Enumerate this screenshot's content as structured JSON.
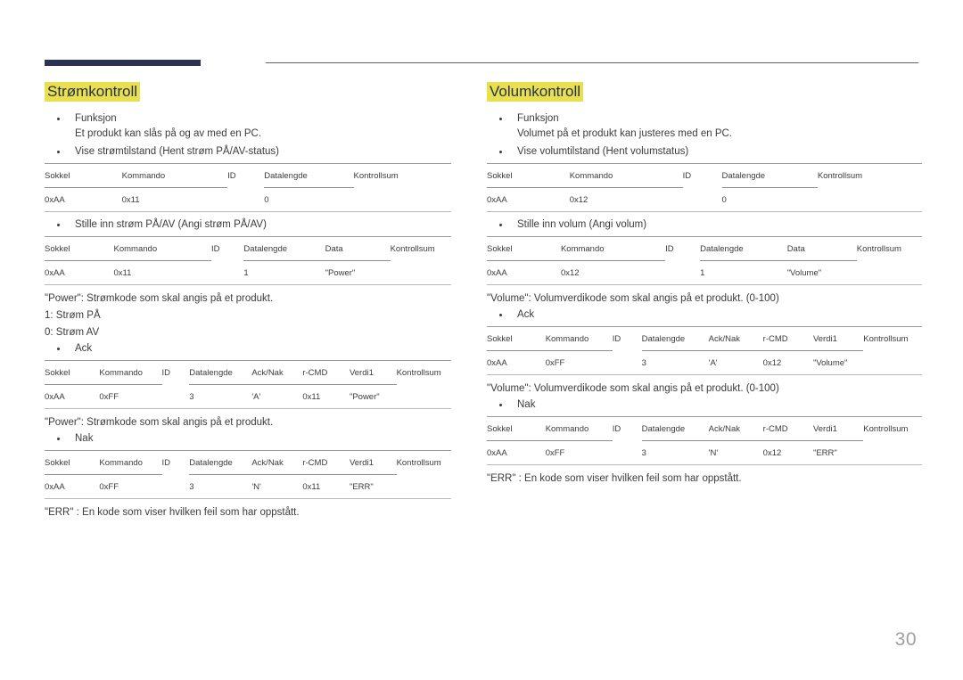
{
  "page": {
    "number": "30",
    "accent_bar_color": "#2b3254",
    "rule_color": "#5b5f75",
    "highlight_color": "#e9e04f",
    "heading_color": "#27304f"
  },
  "table_headers": {
    "sokkel": "Sokkel",
    "kommando": "Kommando",
    "id": "ID",
    "datalengde": "Datalengde",
    "kontrollsum": "Kontrollsum",
    "data": "Data",
    "acknak": "Ack/Nak",
    "rcmd": "r-CMD",
    "verdi1": "Verdi1"
  },
  "left": {
    "title": "Strømkontroll",
    "funksjon_label": "Funksjon",
    "funksjon_desc": "Et produkt kan slås på og av med en PC.",
    "view_state_label": "Vise strømtilstand (Hent strøm PÅ/AV-status)",
    "view_state_row": {
      "sokkel": "0xAA",
      "kommando": "0x11",
      "id": "",
      "datalengde": "0",
      "kontrollsum": ""
    },
    "set_state_label": "Stille inn strøm PÅ/AV (Angi strøm PÅ/AV)",
    "set_state_row": {
      "sokkel": "0xAA",
      "kommando": "0x11",
      "id": "",
      "datalengde": "1",
      "data": "\"Power\"",
      "kontrollsum": ""
    },
    "power_note": "\"Power\": Strømkode som skal angis på et produkt.",
    "power_on": "1: Strøm PÅ",
    "power_off": "0: Strøm AV",
    "ack_label": "Ack",
    "ack_row": {
      "sokkel": "0xAA",
      "kommando": "0xFF",
      "id": "",
      "datalengde": "3",
      "acknak": "'A'",
      "rcmd": "0x11",
      "verdi1": "\"Power\"",
      "kontrollsum": ""
    },
    "power_note_2": "\"Power\": Strømkode som skal angis på et produkt.",
    "nak_label": "Nak",
    "nak_row": {
      "sokkel": "0xAA",
      "kommando": "0xFF",
      "id": "",
      "datalengde": "3",
      "acknak": "'N'",
      "rcmd": "0x11",
      "verdi1": "\"ERR\"",
      "kontrollsum": ""
    },
    "err_note": "\"ERR\" : En kode som viser hvilken feil som har oppstått."
  },
  "right": {
    "title": "Volumkontroll",
    "funksjon_label": "Funksjon",
    "funksjon_desc": "Volumet på et produkt kan justeres med en PC.",
    "view_state_label": "Vise volumtilstand (Hent volumstatus)",
    "view_state_row": {
      "sokkel": "0xAA",
      "kommando": "0x12",
      "id": "",
      "datalengde": "0",
      "kontrollsum": ""
    },
    "set_state_label": "Stille inn volum (Angi volum)",
    "set_state_row": {
      "sokkel": "0xAA",
      "kommando": "0x12",
      "id": "",
      "datalengde": "1",
      "data": "\"Volume\"",
      "kontrollsum": ""
    },
    "volume_note": "\"Volume\": Volumverdikode som skal angis på et produkt. (0-100)",
    "ack_label": "Ack",
    "ack_row": {
      "sokkel": "0xAA",
      "kommando": "0xFF",
      "id": "",
      "datalengde": "3",
      "acknak": "'A'",
      "rcmd": "0x12",
      "verdi1": "\"Volume\"",
      "kontrollsum": ""
    },
    "volume_note_2": "\"Volume\": Volumverdikode som skal angis på et produkt. (0-100)",
    "nak_label": "Nak",
    "nak_row": {
      "sokkel": "0xAA",
      "kommando": "0xFF",
      "id": "",
      "datalengde": "3",
      "acknak": "'N'",
      "rcmd": "0x12",
      "verdi1": "\"ERR\"",
      "kontrollsum": ""
    },
    "err_note": "\"ERR\" : En kode som viser hvilken feil som har oppstått."
  }
}
